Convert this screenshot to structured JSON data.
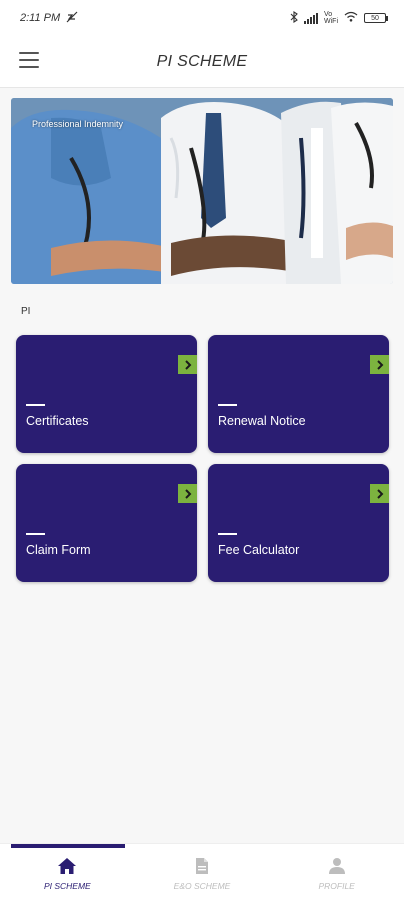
{
  "status_bar": {
    "time": "2:11 PM",
    "lte_top": "Vo",
    "lte_bottom": "WiFi",
    "battery": "50"
  },
  "app_bar": {
    "title": "PI SCHEME"
  },
  "hero": {
    "caption": "Professional Indemnity"
  },
  "section": {
    "label": "PI"
  },
  "cards": [
    {
      "label": "Certificates"
    },
    {
      "label": "Renewal Notice"
    },
    {
      "label": "Claim Form"
    },
    {
      "label": "Fee Calculator"
    }
  ],
  "bottom_nav": {
    "items": [
      {
        "label": "PI SCHEME",
        "icon": "home-icon"
      },
      {
        "label": "E&O SCHEME",
        "icon": "document-icon"
      },
      {
        "label": "PROFILE",
        "icon": "person-icon"
      }
    ]
  },
  "colors": {
    "card_bg": "#2a1d72",
    "accent_green": "#7cb33f",
    "nav_active": "#2a1d72",
    "nav_inactive": "#bdbdbd"
  }
}
